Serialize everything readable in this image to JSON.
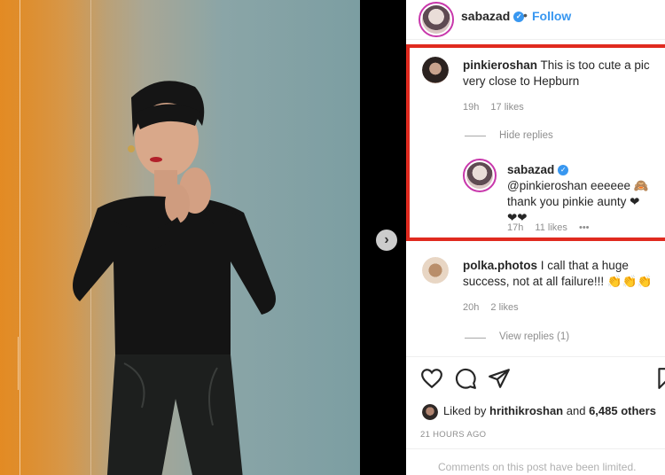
{
  "post": {
    "author": "sabazad",
    "follow_label": "Follow",
    "dot": "•",
    "verified_mark": "✓"
  },
  "comments": [
    {
      "user": "pinkieroshan",
      "text": "This is too cute a pic very close to Hepburn",
      "time": "19h",
      "likes": "17 likes",
      "toggle": "Hide replies"
    },
    {
      "user": "sabazad",
      "text": "@pinkieroshan eeeeee 🙈 thank you pinkie aunty ❤❤❤",
      "time": "17h",
      "likes": "11 likes",
      "more": "•••"
    },
    {
      "user": "polka.photos",
      "text": "I call that a huge success, not at all failure!!! 👏👏👏",
      "time": "20h",
      "likes": "2 likes",
      "toggle": "View replies (1)"
    }
  ],
  "liked_by": {
    "prefix": "Liked by",
    "user": "hrithikroshan",
    "connector": "and",
    "others": "6,485 others"
  },
  "time_ago": "21 HOURS AGO",
  "limited_notice": "Comments on this post have been limited.",
  "nav": {
    "next_arrow": "›"
  },
  "icons": [
    "heart-icon",
    "comment-icon",
    "share-icon",
    "bookmark-icon"
  ],
  "colors": {
    "accent": "#3897f0",
    "highlight": "#e02a1f"
  }
}
